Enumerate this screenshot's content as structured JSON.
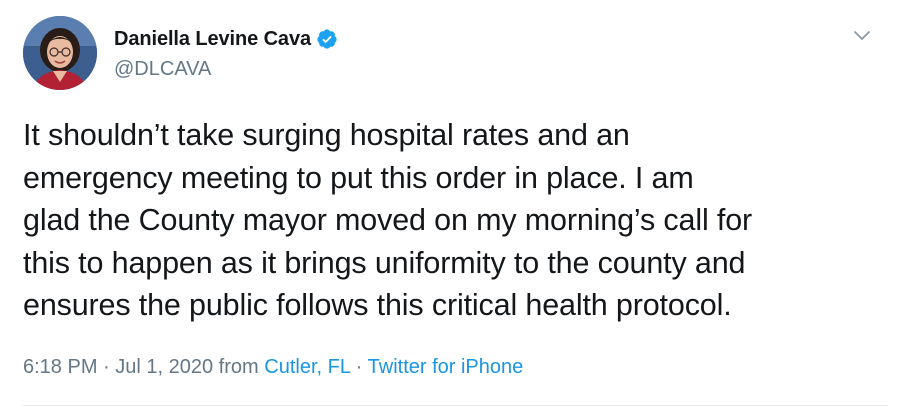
{
  "tweet": {
    "author": {
      "display_name": "Daniella Levine Cava",
      "handle": "@DLCAVA",
      "verified": true
    },
    "text": "It shouldn’t take surging hospital rates and an\nemergency meeting to put this order in place. I am\nglad the County mayor moved on my morning’s call for\nthis to happen as it brings uniformity to the county and\nensures the public follows this critical health protocol.",
    "time": "6:18 PM",
    "separator": " · ",
    "date": "Jul 1, 2020",
    "from_word": " from ",
    "location": "Cutler, FL",
    "source": "Twitter for iPhone"
  },
  "colors": {
    "text": "#14171a",
    "secondary": "#657786",
    "link": "#1b95e0",
    "verified_badge": "#1da1f2",
    "divider": "#e6ecf0"
  },
  "icons": {
    "verified": "verified-badge-icon",
    "menu": "chevron-down-icon"
  }
}
